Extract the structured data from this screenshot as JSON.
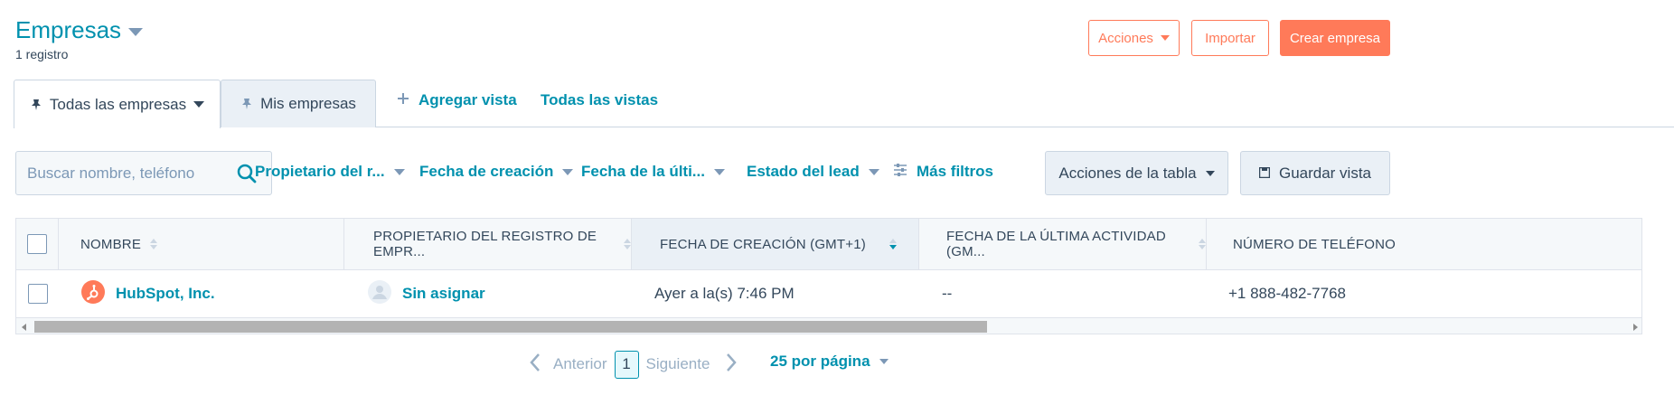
{
  "header": {
    "title": "Empresas",
    "record_count": "1 registro"
  },
  "actions": {
    "acciones_label": "Acciones",
    "importar_label": "Importar",
    "crear_label": "Crear empresa"
  },
  "tabs": [
    {
      "label": "Todas las empresas"
    },
    {
      "label": "Mis empresas"
    }
  ],
  "view_links": {
    "add_view": "Agregar vista",
    "all_views": "Todas las vistas"
  },
  "search": {
    "placeholder": "Buscar nombre, teléfono"
  },
  "filters": {
    "owner": "Propietario del r...",
    "created": "Fecha de creación",
    "last_activity": "Fecha de la últi...",
    "lead_status": "Estado del lead",
    "more": "Más filtros"
  },
  "table_actions": {
    "table_actions_label": "Acciones de la tabla",
    "save_view_label": "Guardar vista"
  },
  "table": {
    "columns": [
      "NOMBRE",
      "PROPIETARIO DEL REGISTRO DE EMPR...",
      "FECHA DE CREACIÓN (GMT+1)",
      "FECHA DE LA ÚLTIMA ACTIVIDAD (GM...",
      "NÚMERO DE TELÉFONO"
    ],
    "rows": [
      {
        "name": "HubSpot, Inc.",
        "owner": "Sin asignar",
        "created": "Ayer a la(s) 7:46 PM",
        "last_activity": "--",
        "phone": "+1 888-482-7768"
      }
    ],
    "scroll_position": 0
  },
  "pagination": {
    "prev": "Anterior",
    "current_page": "1",
    "next": "Siguiente",
    "per_page": "25 por página"
  },
  "colors": {
    "accent": "#0091ae",
    "primary": "#ff7a59",
    "text": "#33475b"
  }
}
